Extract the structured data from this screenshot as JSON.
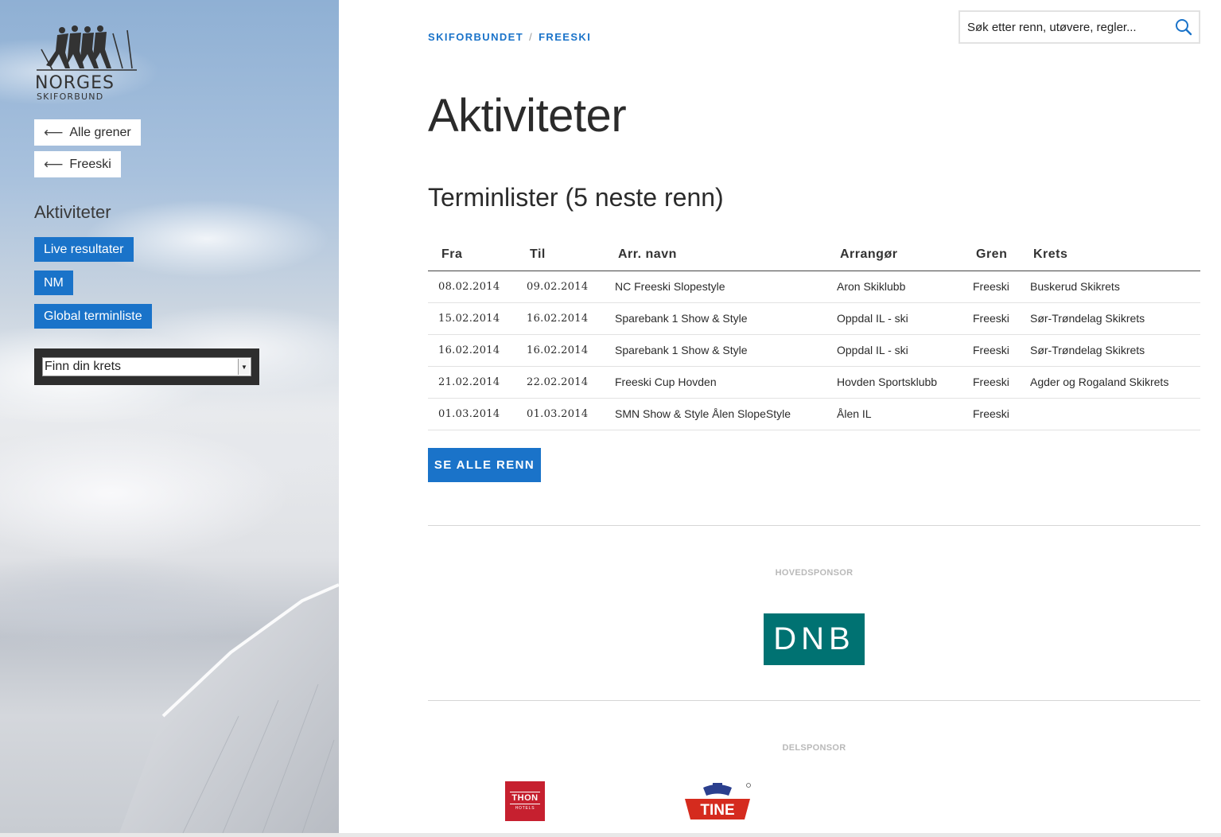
{
  "sidebar": {
    "logo": {
      "line1": "NORGES",
      "line2": "SKIFORBUND",
      "icon": "skiers-logo-icon"
    },
    "back_links": [
      {
        "label": "Alle grener",
        "icon": "arrow-left-icon"
      },
      {
        "label": "Freeski",
        "icon": "arrow-left-icon"
      }
    ],
    "heading": "Aktiviteter",
    "links": [
      {
        "label": "Live resultater"
      },
      {
        "label": "NM"
      },
      {
        "label": "Global terminliste"
      }
    ],
    "krets_select": {
      "value": "Finn din krets",
      "icon": "dropdown-arrow-icon"
    }
  },
  "breadcrumb": {
    "items": [
      "SKIFORBUNDET",
      "FREESKI"
    ],
    "separator": "/"
  },
  "search": {
    "placeholder": "Søk etter renn, utøvere, regler...",
    "icon": "search-icon"
  },
  "main": {
    "page_title": "Aktiviteter",
    "section_title": "Terminlister (5 neste renn)",
    "table": {
      "headers": [
        "Fra",
        "Til",
        "Arr. navn",
        "Arrangør",
        "Gren",
        "Krets"
      ],
      "rows": [
        [
          "08.02.2014",
          "09.02.2014",
          "NC Freeski Slopestyle",
          "Aron Skiklubb",
          "Freeski",
          "Buskerud Skikrets"
        ],
        [
          "15.02.2014",
          "16.02.2014",
          "Sparebank 1 Show & Style",
          "Oppdal IL - ski",
          "Freeski",
          "Sør-Trøndelag Skikrets"
        ],
        [
          "16.02.2014",
          "16.02.2014",
          "Sparebank 1 Show & Style",
          "Oppdal IL - ski",
          "Freeski",
          "Sør-Trøndelag Skikrets"
        ],
        [
          "21.02.2014",
          "22.02.2014",
          "Freeski Cup Hovden",
          "Hovden Sportsklubb",
          "Freeski",
          "Agder og Rogaland Skikrets"
        ],
        [
          "01.03.2014",
          "01.03.2014",
          "SMN Show & Style Ålen SlopeStyle",
          "Ålen IL",
          "Freeski",
          ""
        ]
      ]
    },
    "see_all_label": "SE ALLE RENN"
  },
  "sponsors": {
    "main_label": "HOVEDSPONSOR",
    "main_logo": {
      "name": "DNB",
      "text": "DNB",
      "color": "#007272"
    },
    "partner_label": "DELSPONSOR",
    "partner_logos": [
      {
        "name": "thon-hotels-logo",
        "text": "THON",
        "subtext": "HOTELS",
        "color": "#c6202f"
      },
      {
        "name": "tine-logo",
        "text": "TINE",
        "color": "#d52b1e"
      }
    ]
  },
  "colors": {
    "accent": "#1a73c9",
    "text": "#2b2b2b",
    "dnb": "#007272"
  }
}
